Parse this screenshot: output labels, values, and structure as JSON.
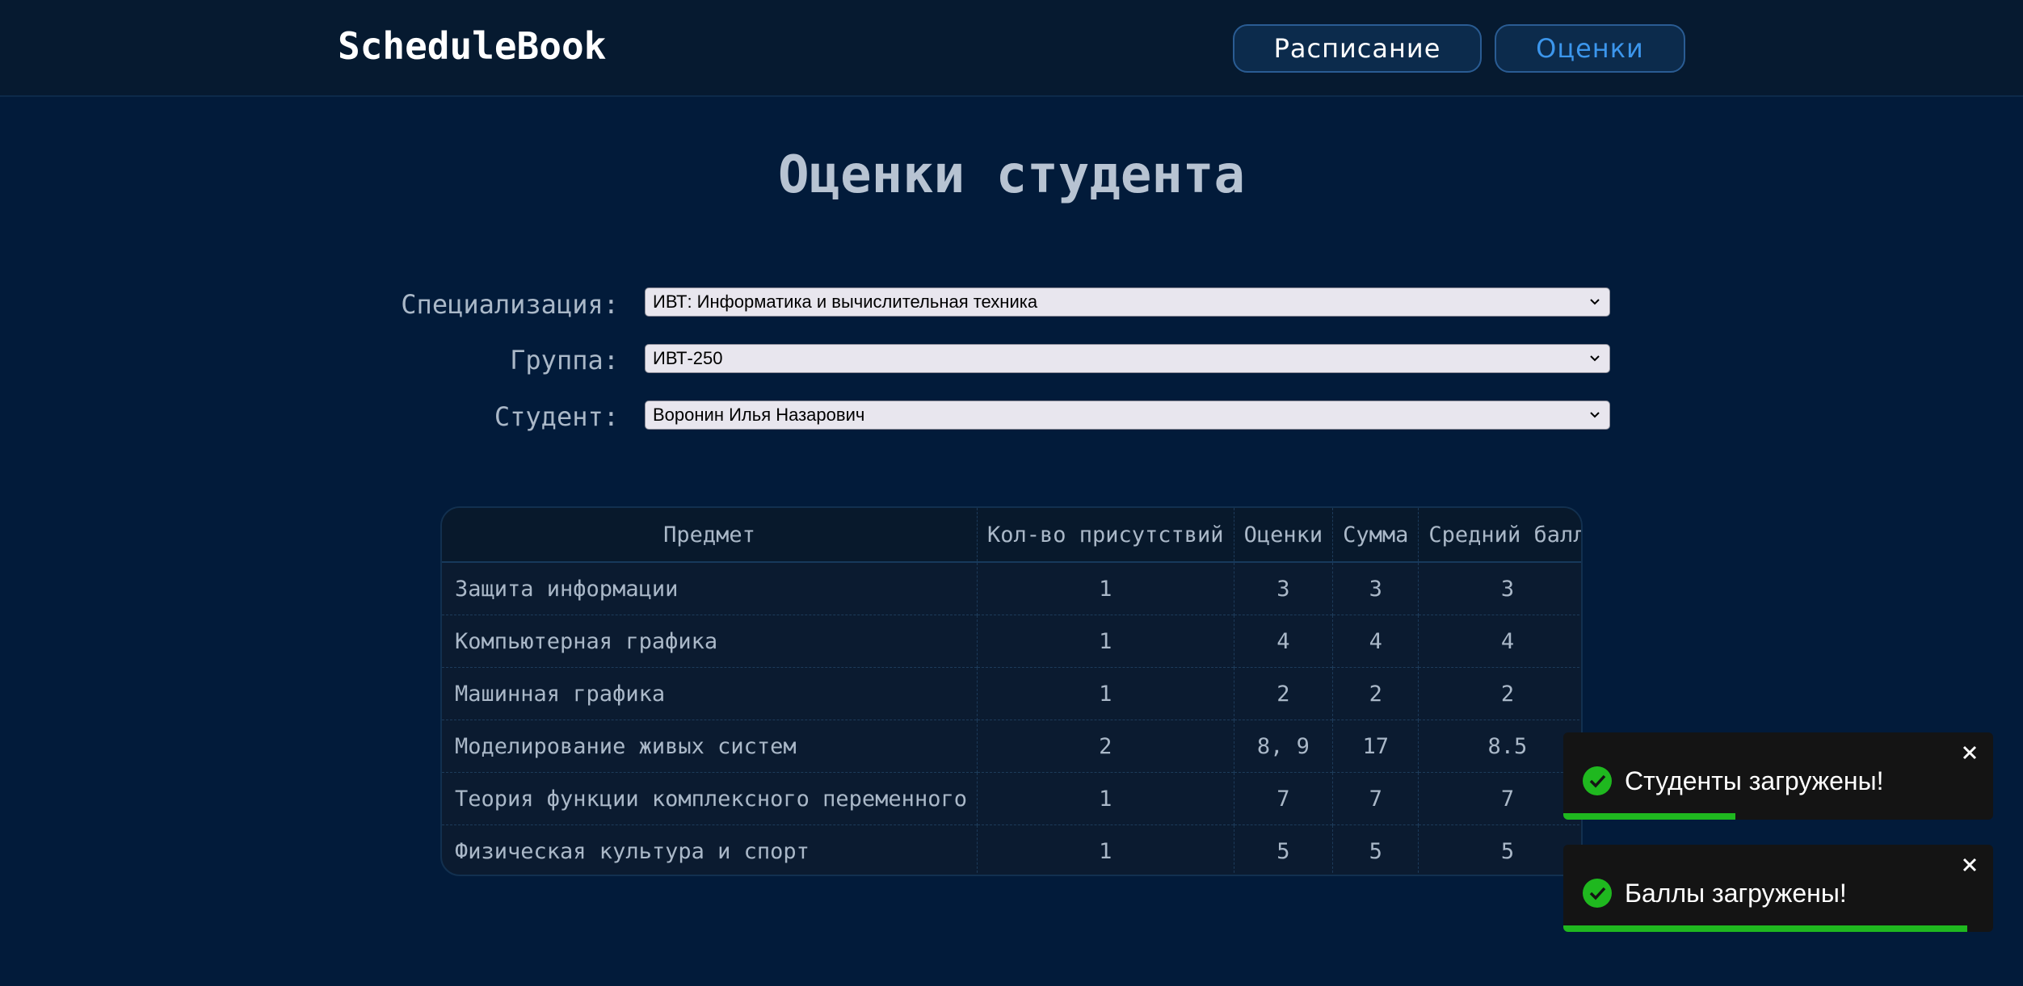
{
  "header": {
    "logo": "ScheduleBook",
    "nav": [
      {
        "label": "Расписание"
      },
      {
        "label": "Оценки"
      }
    ]
  },
  "page": {
    "title": "Оценки студента"
  },
  "filters": {
    "specialization": {
      "label": "Специализация:",
      "value": "ИВТ: Информатика и вычислительная техника"
    },
    "group": {
      "label": "Группа:",
      "value": "ИВТ-250"
    },
    "student": {
      "label": "Студент:",
      "value": "Воронин Илья Назарович"
    }
  },
  "grades_table": {
    "columns": [
      "Предмет",
      "Кол-во присутствий",
      "Оценки",
      "Сумма",
      "Средний балл"
    ],
    "rows": [
      [
        "Защита информации",
        "1",
        "3",
        "3",
        "3"
      ],
      [
        "Компьютерная графика",
        "1",
        "4",
        "4",
        "4"
      ],
      [
        "Машинная графика",
        "1",
        "2",
        "2",
        "2"
      ],
      [
        "Моделирование живых систем",
        "2",
        "8, 9",
        "17",
        "8.5"
      ],
      [
        "Теория функции комплексного переменного",
        "1",
        "7",
        "7",
        "7"
      ],
      [
        "Физическая культура и спорт",
        "1",
        "5",
        "5",
        "5"
      ]
    ]
  },
  "toasts": [
    {
      "message": "Студенты загружены!",
      "progress": 0.4
    },
    {
      "message": "Баллы загружены!",
      "progress": 0.94
    }
  ],
  "colors": {
    "background": "#021b3a",
    "header": "#061a30",
    "accent": "#3c96ec",
    "success": "#1fb81f"
  }
}
